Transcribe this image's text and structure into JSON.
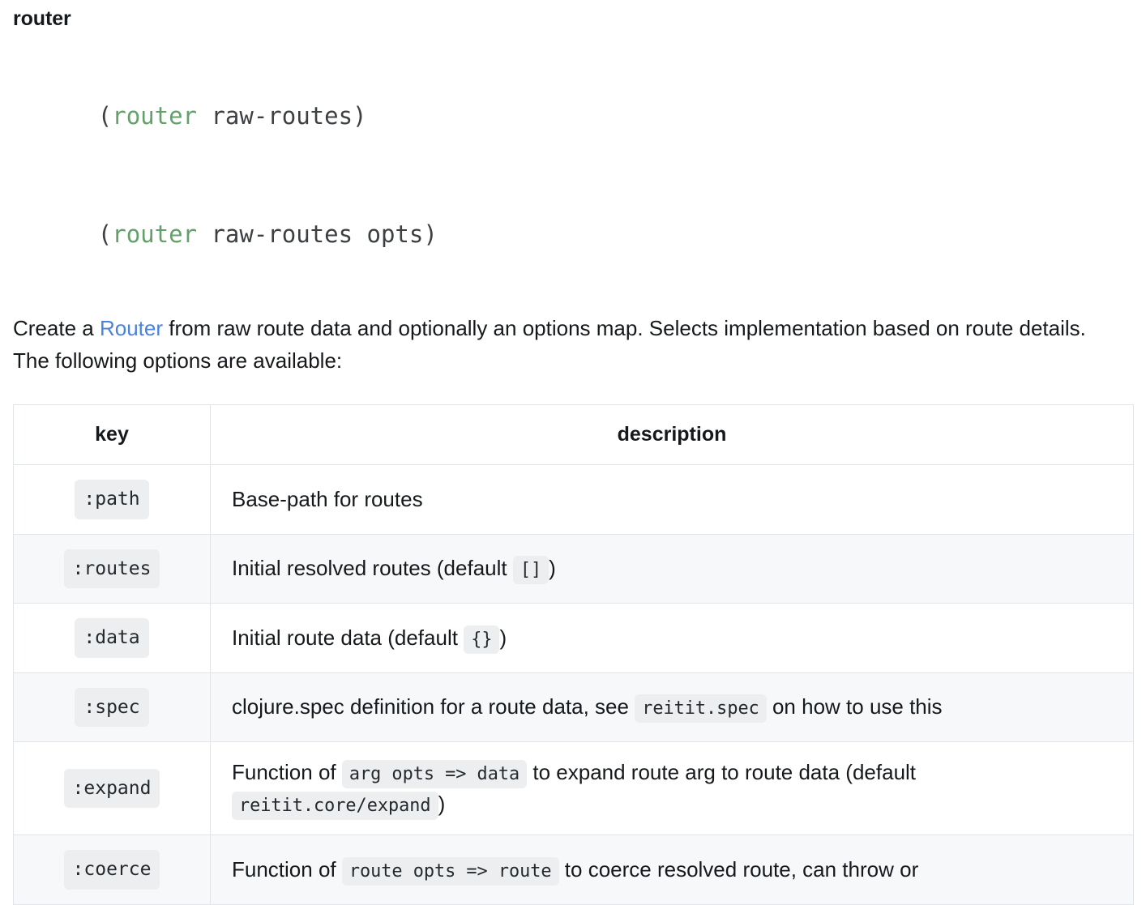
{
  "heading": "router",
  "signatures": [
    {
      "open": "(",
      "fn": "router",
      "args": " raw-routes)"
    },
    {
      "open": "(",
      "fn": "router",
      "args": " raw-routes opts)"
    }
  ],
  "description": {
    "before_link": "Create a ",
    "link_text": "Router",
    "after_link": " from raw route data and optionally an options map. Selects implementation based on route details. The following options are available:"
  },
  "table": {
    "headers": [
      "key",
      "description"
    ],
    "rows": [
      {
        "key": ":path",
        "parts": [
          {
            "type": "text",
            "value": "Base-path for routes"
          }
        ]
      },
      {
        "key": ":routes",
        "parts": [
          {
            "type": "text",
            "value": "Initial resolved routes (default "
          },
          {
            "type": "code",
            "value": "[]"
          },
          {
            "type": "text",
            "value": ")"
          }
        ]
      },
      {
        "key": ":data",
        "parts": [
          {
            "type": "text",
            "value": "Initial route data (default "
          },
          {
            "type": "code",
            "value": "{}"
          },
          {
            "type": "text",
            "value": ")"
          }
        ]
      },
      {
        "key": ":spec",
        "parts": [
          {
            "type": "text",
            "value": "clojure.spec definition for a route data, see "
          },
          {
            "type": "code",
            "value": "reitit.spec"
          },
          {
            "type": "text",
            "value": " on how to use this"
          }
        ]
      },
      {
        "key": ":expand",
        "parts": [
          {
            "type": "text",
            "value": "Function of "
          },
          {
            "type": "code",
            "value": "arg opts => data"
          },
          {
            "type": "text",
            "value": " to expand route arg to route data (default "
          },
          {
            "type": "code",
            "value": "reitit.core/expand"
          },
          {
            "type": "text",
            "value": ")"
          }
        ]
      },
      {
        "key": ":coerce",
        "parts": [
          {
            "type": "text",
            "value": "Function of "
          },
          {
            "type": "code",
            "value": "route opts => route"
          },
          {
            "type": "text",
            "value": " to coerce resolved route, can throw or"
          }
        ]
      }
    ]
  },
  "colors": {
    "link": "#4a82e0",
    "code_keyword": "#63a06a",
    "code_bg": "#eceef0",
    "table_border": "#e1e4e8",
    "row_alt_bg": "#f6f8fa",
    "text": "#16191c"
  }
}
